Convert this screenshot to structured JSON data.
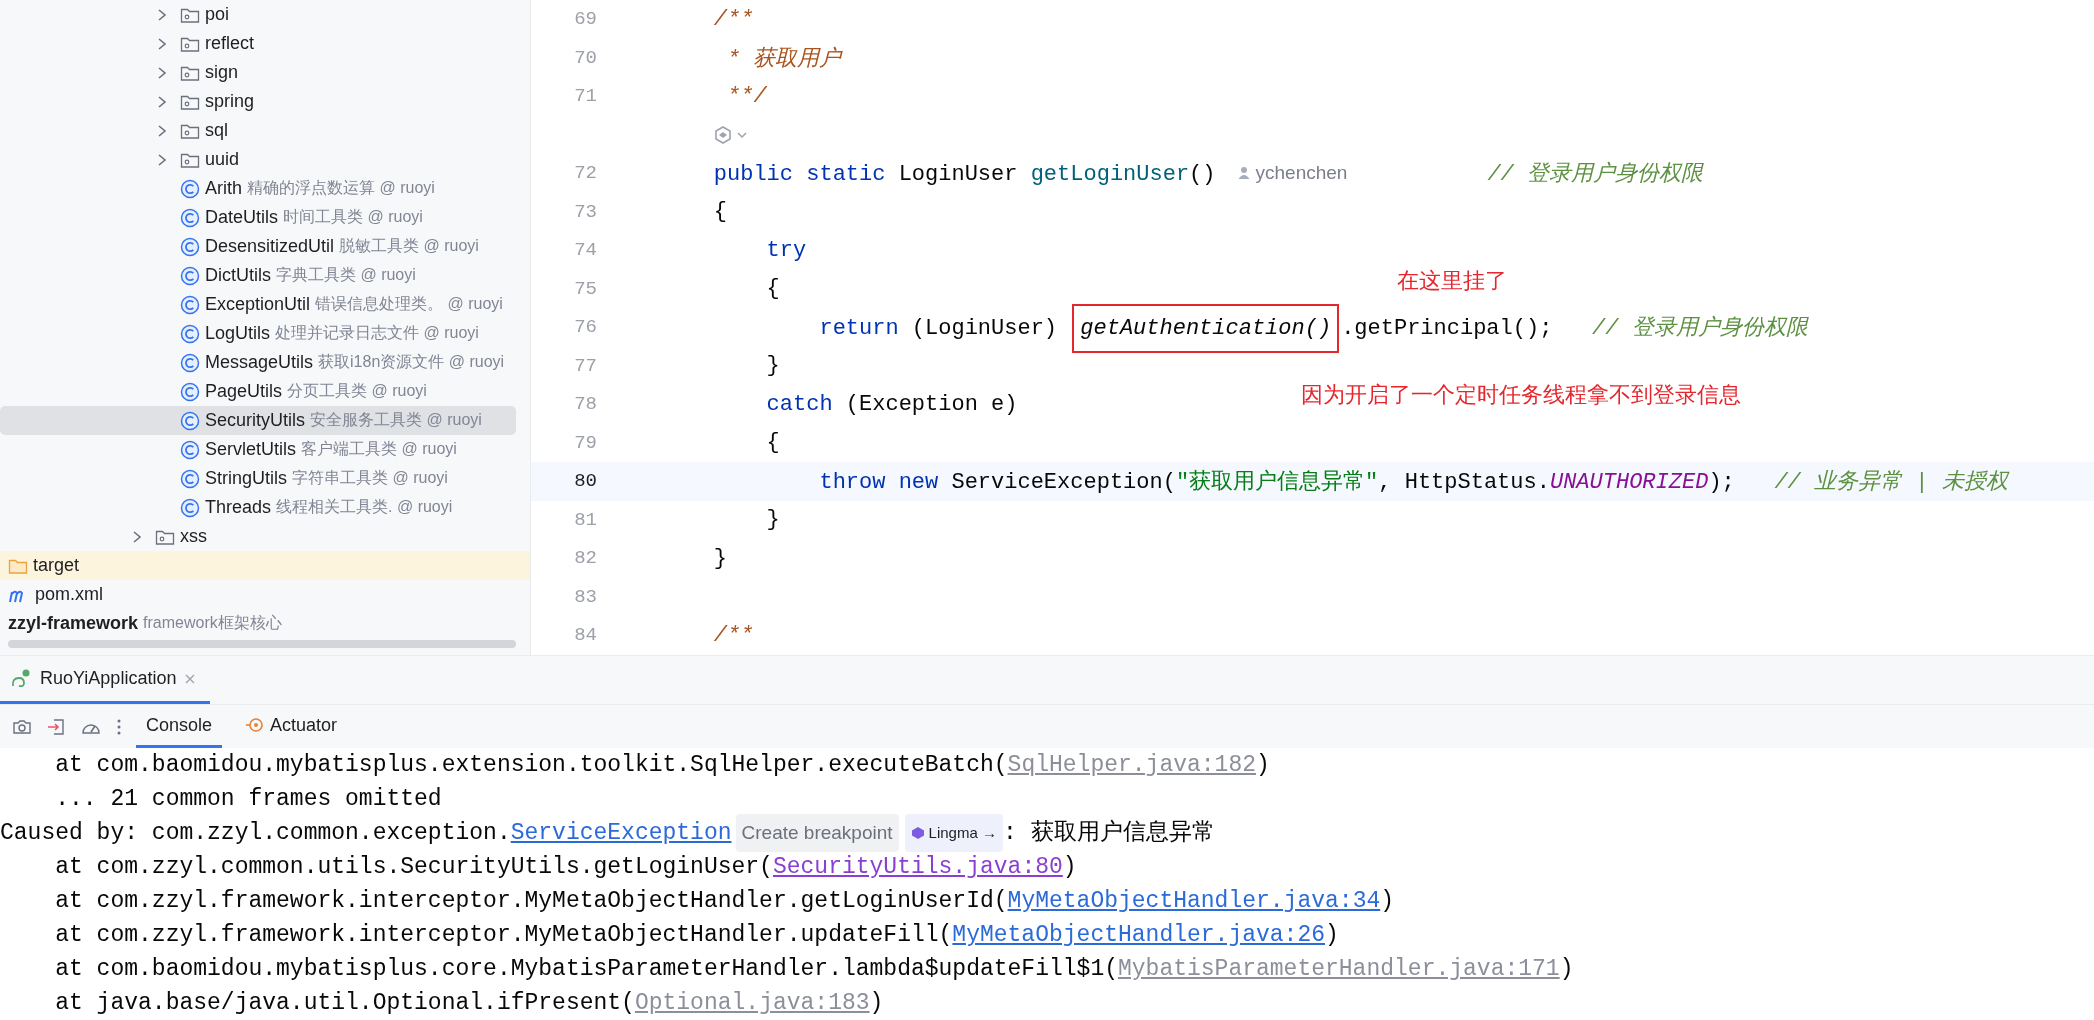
{
  "tree": [
    {
      "children": [
        {
          "children": [
            {
              "kind": "package",
              "label": "poi",
              "expanded": false,
              "selected": false
            },
            {
              "kind": "package",
              "label": "reflect",
              "expanded": false,
              "selected": false
            },
            {
              "kind": "package",
              "label": "sign",
              "expanded": false,
              "selected": false
            },
            {
              "kind": "package",
              "label": "spring",
              "expanded": false,
              "selected": false
            },
            {
              "kind": "package",
              "label": "sql",
              "expanded": false,
              "selected": false
            },
            {
              "kind": "package",
              "label": "uuid",
              "expanded": false,
              "selected": false
            },
            {
              "kind": "class",
              "label": "Arith",
              "description": "精确的浮点数运算 @ ruoyi",
              "selected": false
            },
            {
              "kind": "class",
              "label": "DateUtils",
              "description": "时间工具类 @ ruoyi",
              "selected": false
            },
            {
              "kind": "class",
              "label": "DesensitizedUtil",
              "description": "脱敏工具类 @ ruoyi",
              "selected": false
            },
            {
              "kind": "class",
              "label": "DictUtils",
              "description": "字典工具类 @ ruoyi",
              "selected": false
            },
            {
              "kind": "class",
              "label": "ExceptionUtil",
              "description": "错误信息处理类。 @ ruoyi",
              "selected": false
            },
            {
              "kind": "class",
              "label": "LogUtils",
              "description": "处理并记录日志文件 @ ruoyi",
              "selected": false
            },
            {
              "kind": "class",
              "label": "MessageUtils",
              "description": "获取i18n资源文件 @ ruoyi",
              "selected": false
            },
            {
              "kind": "class",
              "label": "PageUtils",
              "description": "分页工具类 @ ruoyi",
              "selected": false
            },
            {
              "kind": "class",
              "label": "SecurityUtils",
              "description": "安全服务工具类 @ ruoyi",
              "selected": true
            },
            {
              "kind": "class",
              "label": "ServletUtils",
              "description": "客户端工具类 @ ruoyi",
              "selected": false
            },
            {
              "kind": "class",
              "label": "StringUtils",
              "description": "字符串工具类 @ ruoyi",
              "selected": false
            },
            {
              "kind": "class",
              "label": "Threads",
              "description": "线程相关工具类. @ ruoyi",
              "selected": false
            }
          ]
        },
        {
          "kind": "package",
          "label": "xss",
          "expanded": false,
          "selected": false
        }
      ]
    },
    {
      "kind": "excluded-folder",
      "label": "target",
      "selected": false
    },
    {
      "kind": "maven-file",
      "label": "pom.xml",
      "selected": false
    },
    {
      "kind": "module",
      "label": "zzyl-framework",
      "description": "framework框架核心",
      "selected": false
    }
  ],
  "editor": {
    "lines": [
      {
        "kind": "code",
        "number": "69",
        "current": false,
        "tokens": [
          {
            "kind": "doc",
            "text": "    /**"
          }
        ]
      },
      {
        "kind": "code",
        "number": "70",
        "current": false,
        "tokens": [
          {
            "kind": "doc",
            "text": "     * 获取用户"
          }
        ]
      },
      {
        "kind": "code",
        "number": "71",
        "current": false,
        "tokens": [
          {
            "kind": "doc",
            "text": "     **/"
          }
        ]
      },
      {
        "kind": "inlay"
      },
      {
        "kind": "code",
        "number": "72",
        "current": false,
        "tokens": [
          {
            "kind": "keyword",
            "text": "    public static"
          },
          {
            "kind": "plain",
            "text": " LoginUser "
          },
          {
            "kind": "method",
            "text": "getLoginUser"
          },
          {
            "kind": "plain",
            "text": "()"
          },
          {
            "kind": "author",
            "text": "ychenchen"
          },
          {
            "kind": "comment",
            "text": "// 登录用户身份权限"
          }
        ]
      },
      {
        "kind": "code",
        "number": "73",
        "current": false,
        "tokens": [
          {
            "kind": "plain",
            "text": "    {"
          }
        ]
      },
      {
        "kind": "code",
        "number": "74",
        "current": false,
        "tokens": [
          {
            "kind": "keyword",
            "text": "        try"
          }
        ]
      },
      {
        "kind": "code",
        "number": "75",
        "current": false,
        "tokens": [
          {
            "kind": "plain",
            "text": "        {"
          }
        ]
      },
      {
        "kind": "code",
        "number": "76",
        "current": false,
        "tokens": [
          {
            "kind": "keyword",
            "text": "            return"
          },
          {
            "kind": "plain",
            "text": " (LoginUser) "
          },
          {
            "kind": "boxed",
            "text": "getAuthentication()"
          },
          {
            "kind": "plain",
            "text": ".getPrincipal();   "
          },
          {
            "kind": "comment",
            "text": "// 登录用户身份权限"
          }
        ]
      },
      {
        "kind": "code",
        "number": "77",
        "current": false,
        "tokens": [
          {
            "kind": "plain",
            "text": "        }"
          }
        ]
      },
      {
        "kind": "code",
        "number": "78",
        "current": false,
        "tokens": [
          {
            "kind": "keyword",
            "text": "        catch"
          },
          {
            "kind": "plain",
            "text": " (Exception e)"
          }
        ]
      },
      {
        "kind": "code",
        "number": "79",
        "current": false,
        "tokens": [
          {
            "kind": "plain",
            "text": "        {"
          }
        ]
      },
      {
        "kind": "code",
        "number": "80",
        "current": true,
        "tokens": [
          {
            "kind": "keyword",
            "text": "            throw new"
          },
          {
            "kind": "plain",
            "text": " ServiceException("
          },
          {
            "kind": "string",
            "text": "\"获取用户信息异常\""
          },
          {
            "kind": "plain",
            "text": ", HttpStatus."
          },
          {
            "kind": "constant",
            "text": "UNAUTHORIZED"
          },
          {
            "kind": "plain",
            "text": ");   "
          },
          {
            "kind": "comment",
            "text": "// 业务异常 | 未授权"
          }
        ]
      },
      {
        "kind": "code",
        "number": "81",
        "current": false,
        "tokens": [
          {
            "kind": "plain",
            "text": "        }"
          }
        ]
      },
      {
        "kind": "code",
        "number": "82",
        "current": false,
        "tokens": [
          {
            "kind": "plain",
            "text": "    }"
          }
        ]
      },
      {
        "kind": "code",
        "number": "83",
        "current": false
      },
      {
        "kind": "code",
        "number": "84",
        "current": false,
        "tokens": [
          {
            "kind": "doc",
            "text": "    /**"
          }
        ]
      }
    ],
    "annotations": [
      {
        "text": "在这里挂了"
      },
      {
        "text": "因为开启了一个定时任务线程拿不到登录信息"
      }
    ]
  },
  "run_tabs": [
    {
      "label": "RuoYiApplication",
      "selected": true
    }
  ],
  "console_tabs": [
    {
      "label": "Console",
      "kind": "console",
      "selected": true
    },
    {
      "label": "Actuator",
      "kind": "actuator",
      "selected": false
    }
  ],
  "console": [
    {
      "segments": [
        {
          "kind": "plain",
          "text": "    at com.baomidou.mybatisplus.extension.toolkit.SqlHelper.executeBatch("
        },
        {
          "kind": "library-link",
          "text": "SqlHelper.java:182"
        },
        {
          "kind": "plain",
          "text": ")"
        }
      ]
    },
    {
      "segments": [
        {
          "kind": "plain",
          "text": "    ... 21 common frames omitted"
        }
      ]
    },
    {
      "segments": [
        {
          "kind": "plain",
          "text": "Caused by: com.zzyl.common.exception."
        },
        {
          "kind": "link",
          "text": "ServiceException"
        },
        {
          "kind": "hint-chip",
          "text": "Create breakpoint"
        },
        {
          "kind": "ai-chip",
          "text": "Lingma →"
        },
        {
          "kind": "plain",
          "text": ": 获取用户信息异常"
        }
      ]
    },
    {
      "segments": [
        {
          "kind": "plain",
          "text": "    at com.zzyl.common.utils.SecurityUtils.getLoginUser("
        },
        {
          "kind": "visited-link",
          "text": "SecurityUtils.java:80"
        },
        {
          "kind": "plain",
          "text": ")"
        }
      ]
    },
    {
      "segments": [
        {
          "kind": "plain",
          "text": "    at com.zzyl.framework.interceptor.MyMetaObjectHandler.getLoginUserId("
        },
        {
          "kind": "link",
          "text": "MyMetaObjectHandler.java:34"
        },
        {
          "kind": "plain",
          "text": ")"
        }
      ]
    },
    {
      "segments": [
        {
          "kind": "plain",
          "text": "    at com.zzyl.framework.interceptor.MyMetaObjectHandler.updateFill("
        },
        {
          "kind": "link",
          "text": "MyMetaObjectHandler.java:26"
        },
        {
          "kind": "plain",
          "text": ")"
        }
      ]
    },
    {
      "segments": [
        {
          "kind": "plain",
          "text": "    at com.baomidou.mybatisplus.core.MybatisParameterHandler.lambda$updateFill$1("
        },
        {
          "kind": "library-link",
          "text": "MybatisParameterHandler.java:171"
        },
        {
          "kind": "plain",
          "text": ")"
        }
      ]
    },
    {
      "segments": [
        {
          "kind": "plain",
          "text": "    at java.base/java.util.Optional.ifPresent("
        },
        {
          "kind": "library-link",
          "text": "Optional.java:183"
        },
        {
          "kind": "plain",
          "text": ")"
        }
      ]
    }
  ]
}
